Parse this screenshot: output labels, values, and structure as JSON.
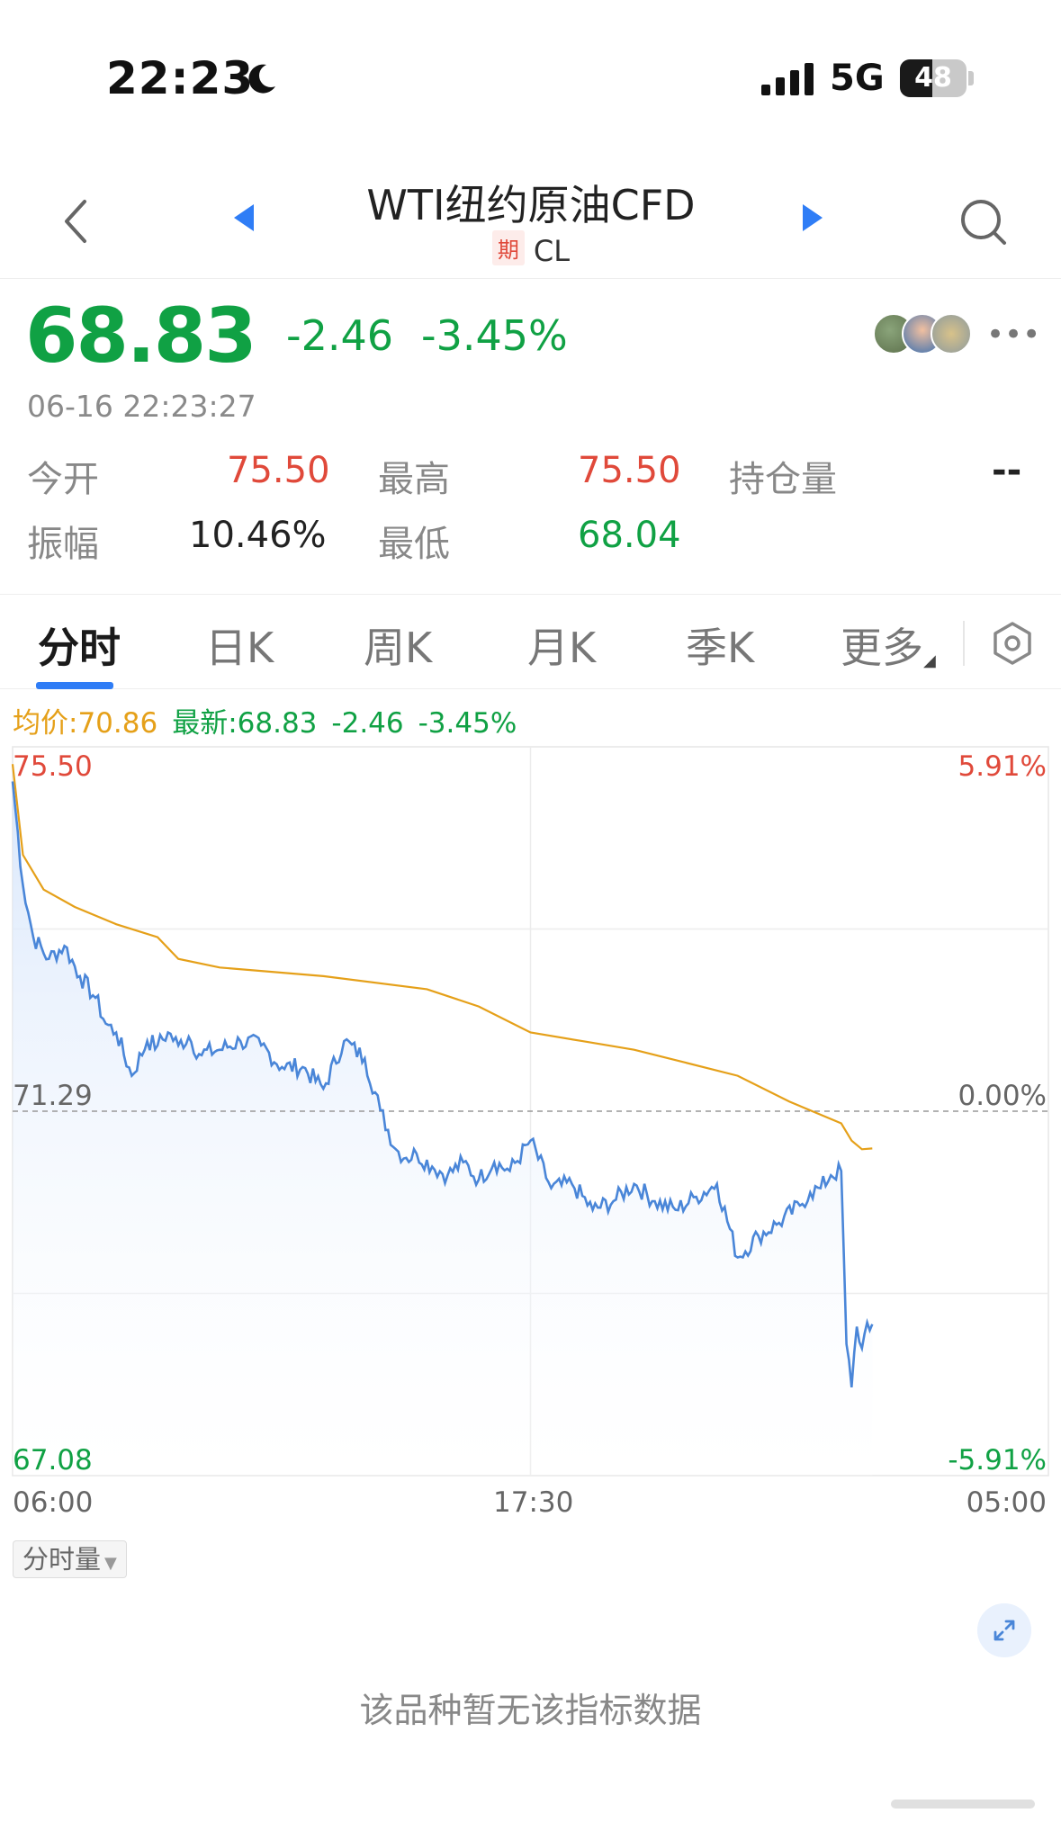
{
  "status_bar": {
    "time": "22:23",
    "network": "5G",
    "battery_level": "48",
    "battery_fraction": 0.48
  },
  "nav": {
    "title": "WTI纽约原油CFD",
    "badge": "期",
    "symbol": "CL"
  },
  "quote": {
    "last_price": "68.83",
    "change": "-2.46",
    "change_pct": "-3.45%",
    "timestamp": "06-16 22:23:27"
  },
  "stats": {
    "open_label": "今开",
    "open_value": "75.50",
    "high_label": "最高",
    "high_value": "75.50",
    "open_interest_label": "持仓量",
    "open_interest_value": "--",
    "amplitude_label": "振幅",
    "amplitude_value": "10.46%",
    "low_label": "最低",
    "low_value": "68.04"
  },
  "tabs": [
    {
      "label": "分时",
      "active": true
    },
    {
      "label": "日K",
      "active": false
    },
    {
      "label": "周K",
      "active": false
    },
    {
      "label": "月K",
      "active": false
    },
    {
      "label": "季K",
      "active": false
    },
    {
      "label": "更多",
      "active": false
    }
  ],
  "legend": {
    "avg": "均价:70.86",
    "latest": "最新:68.83",
    "change": "-2.46",
    "change_pct": "-3.45%"
  },
  "colors": {
    "price_line": "#4a86d8",
    "avg_line": "#e5a019",
    "up": "#e0493a",
    "down": "#10a144",
    "accent": "#2f7df6"
  },
  "chart_data": {
    "type": "line",
    "x_ticks": [
      "06:00",
      "17:30",
      "05:00"
    ],
    "y_left_ticks": [
      "75.50",
      "71.29",
      "67.08"
    ],
    "y_right_ticks": [
      "5.91%",
      "0.00%",
      "-5.91%"
    ],
    "ylim": [
      67.08,
      75.5
    ],
    "reference_value": 71.29,
    "grid": true,
    "series": [
      {
        "role": "price",
        "x": [
          0,
          0.01,
          0.02,
          0.035,
          0.05,
          0.065,
          0.08,
          0.09,
          0.1,
          0.115,
          0.13,
          0.14,
          0.15,
          0.16,
          0.17,
          0.18,
          0.2,
          0.22,
          0.24,
          0.26,
          0.28,
          0.3,
          0.32,
          0.34,
          0.355,
          0.37,
          0.38,
          0.39,
          0.405,
          0.42,
          0.435,
          0.45,
          0.465,
          0.48,
          0.5,
          0.52,
          0.54,
          0.56,
          0.58,
          0.6,
          0.62,
          0.64,
          0.66,
          0.68,
          0.7,
          0.72,
          0.74,
          0.76,
          0.77,
          0.78,
          0.79,
          0.8,
          0.805,
          0.81,
          0.815,
          0.82,
          0.825,
          0.83
        ],
        "values": [
          75.1,
          73.9,
          73.3,
          73.05,
          73.2,
          72.85,
          72.6,
          72.3,
          72.2,
          71.7,
          72.1,
          72.05,
          72.2,
          72.05,
          72.15,
          71.95,
          72.0,
          72.1,
          72.05,
          71.8,
          71.8,
          71.55,
          72.1,
          71.9,
          71.3,
          70.85,
          70.75,
          70.8,
          70.65,
          70.55,
          70.7,
          70.5,
          70.7,
          70.6,
          70.95,
          70.4,
          70.45,
          70.15,
          70.25,
          70.45,
          70.25,
          70.15,
          70.3,
          70.45,
          69.6,
          69.85,
          70.0,
          70.2,
          70.35,
          70.4,
          70.55,
          70.6,
          68.6,
          68.1,
          68.8,
          68.55,
          68.85,
          68.83
        ]
      },
      {
        "role": "average",
        "x": [
          0,
          0.01,
          0.03,
          0.06,
          0.1,
          0.14,
          0.16,
          0.2,
          0.3,
          0.4,
          0.45,
          0.5,
          0.55,
          0.6,
          0.65,
          0.7,
          0.75,
          0.8,
          0.81,
          0.82,
          0.83
        ],
        "values": [
          75.3,
          74.25,
          73.85,
          73.65,
          73.45,
          73.3,
          73.05,
          72.95,
          72.85,
          72.7,
          72.5,
          72.2,
          72.1,
          72.0,
          71.85,
          71.7,
          71.4,
          71.15,
          70.95,
          70.85,
          70.86
        ]
      }
    ]
  },
  "volume": {
    "selector_label": "分时量",
    "empty_message": "该品种暂无该指标数据"
  }
}
